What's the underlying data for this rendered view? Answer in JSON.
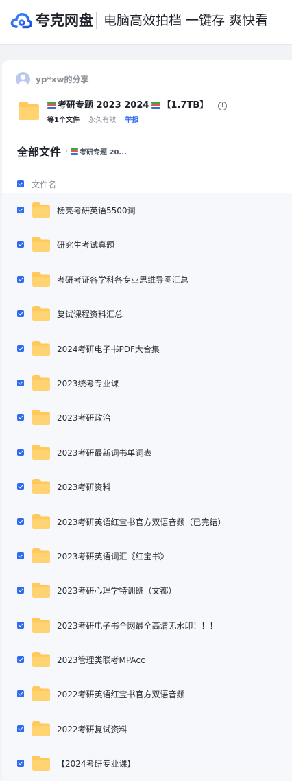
{
  "header": {
    "brand": "夸克网盘",
    "slogan": "电脑高效拍档 一键存 爽快看"
  },
  "share": {
    "owner": "yp*xw的分享",
    "title": "考研专题 2023 2024",
    "size": "【1.7TB】",
    "file_count": "等1个文件",
    "validity": "永久有效",
    "report": "举报"
  },
  "breadcrumb": {
    "root": "全部文件",
    "current": "考研专题 20..."
  },
  "list_header": {
    "column": "文件名"
  },
  "files": [
    "杨亮考研英语5500词",
    "研究生考试真题",
    "考研考证各学科各专业思维导图汇总",
    "复试课程资料汇总",
    "2024考研电子书PDF大合集",
    "2023统考专业课",
    "2023考研政治",
    "2023考研最新词书单词表",
    "2023考研资料",
    "2023考研英语红宝书官方双语音频（已完结）",
    "2023考研英语词汇《红宝书》",
    "2023考研心理学特训班（文都）",
    "2023考研电子书全网最全高清无水印！！！",
    "2023管理类联考MPAcc",
    "2022考研英语红宝书官方双语音频",
    "2022考研复试资料",
    "【2024考研专业课】"
  ],
  "colors": {
    "accent": "#2e6bf0",
    "folder": "#ffc95c",
    "link": "#2f6ef7"
  }
}
